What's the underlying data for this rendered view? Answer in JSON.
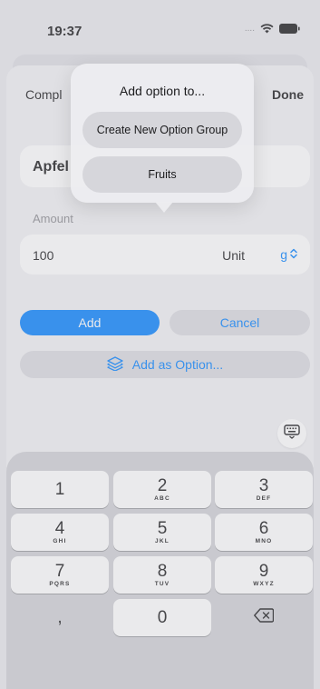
{
  "status": {
    "time": "19:37",
    "signal": "...."
  },
  "nav": {
    "left_label": "Compl",
    "done_label": "Done"
  },
  "form": {
    "name_value": "Apfel",
    "amount_label": "Amount",
    "amount_value": "100",
    "unit_label": "Unit",
    "unit_value": "g"
  },
  "actions": {
    "add_label": "Add",
    "cancel_label": "Cancel",
    "add_option_label": "Add as Option..."
  },
  "popover": {
    "title": "Add option to...",
    "items": [
      "Create New Option Group",
      "Fruits"
    ]
  },
  "keypad": {
    "keys": [
      {
        "digit": "1",
        "letters": ""
      },
      {
        "digit": "2",
        "letters": "ABC"
      },
      {
        "digit": "3",
        "letters": "DEF"
      },
      {
        "digit": "4",
        "letters": "GHI"
      },
      {
        "digit": "5",
        "letters": "JKL"
      },
      {
        "digit": "6",
        "letters": "MNO"
      },
      {
        "digit": "7",
        "letters": "PQRS"
      },
      {
        "digit": "8",
        "letters": "TUV"
      },
      {
        "digit": "9",
        "letters": "WXYZ"
      },
      {
        "digit": ",",
        "letters": ""
      },
      {
        "digit": "0",
        "letters": ""
      }
    ]
  },
  "icons": {
    "wifi": "wifi-icon",
    "battery": "battery-icon",
    "chevron": "chevron-up-down-icon",
    "layers": "layers-icon",
    "keyboard": "keyboard-icon",
    "delete": "delete-backspace-icon"
  },
  "colors": {
    "accent": "#0a84ff",
    "background": "#f1f1f4",
    "keypad": "#d1d2d7"
  }
}
